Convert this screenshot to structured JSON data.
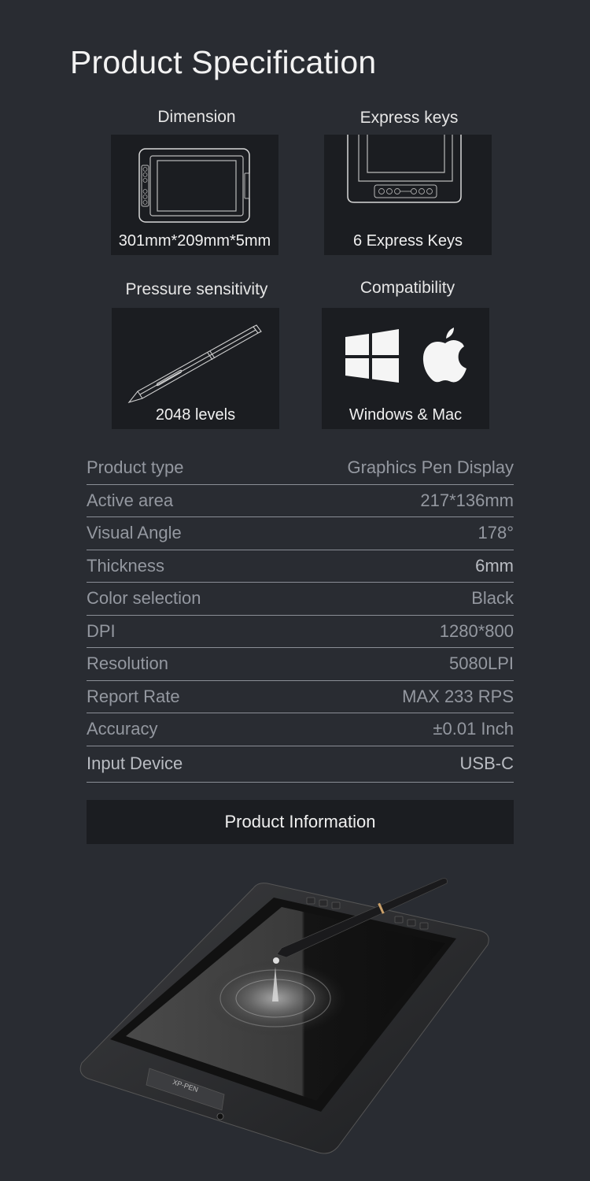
{
  "page": {
    "title": "Product Specification"
  },
  "features": [
    {
      "label": "Dimension",
      "caption": "301mm*209mm*5mm",
      "icon": "tablet-outline-icon"
    },
    {
      "label": "Express keys",
      "caption": "6 Express Keys",
      "icon": "express-keys-outline-icon"
    },
    {
      "label": "Pressure sensitivity",
      "caption": "2048 levels",
      "icon": "pen-outline-icon"
    },
    {
      "label": "Compatibility",
      "caption": "Windows & Mac",
      "icon": "windows-apple-icon"
    }
  ],
  "specs": [
    {
      "key": "Product type",
      "value": "Graphics Pen Display"
    },
    {
      "key": "Active area",
      "value": "217*136mm"
    },
    {
      "key": "Visual Angle",
      "value": "178°"
    },
    {
      "key": "Thickness",
      "value": "6mm"
    },
    {
      "key": "Color selection",
      "value": "Black"
    },
    {
      "key": "DPI",
      "value": "1280*800"
    },
    {
      "key": "Resolution",
      "value": "5080LPI"
    },
    {
      "key": "Report Rate",
      "value": "MAX 233 RPS"
    },
    {
      "key": "Accuracy",
      "value": "±0.01 Inch"
    },
    {
      "key": "Input Device",
      "value": "USB-C"
    }
  ],
  "info": {
    "label": "Product Information"
  },
  "product_image": {
    "brand": "XP-PEN",
    "alt": "Graphics pen display tablet with stylus"
  },
  "colors": {
    "background": "#292c32",
    "card": "#1b1d21",
    "text_muted": "#9498a0",
    "divider": "#8a8e96"
  }
}
